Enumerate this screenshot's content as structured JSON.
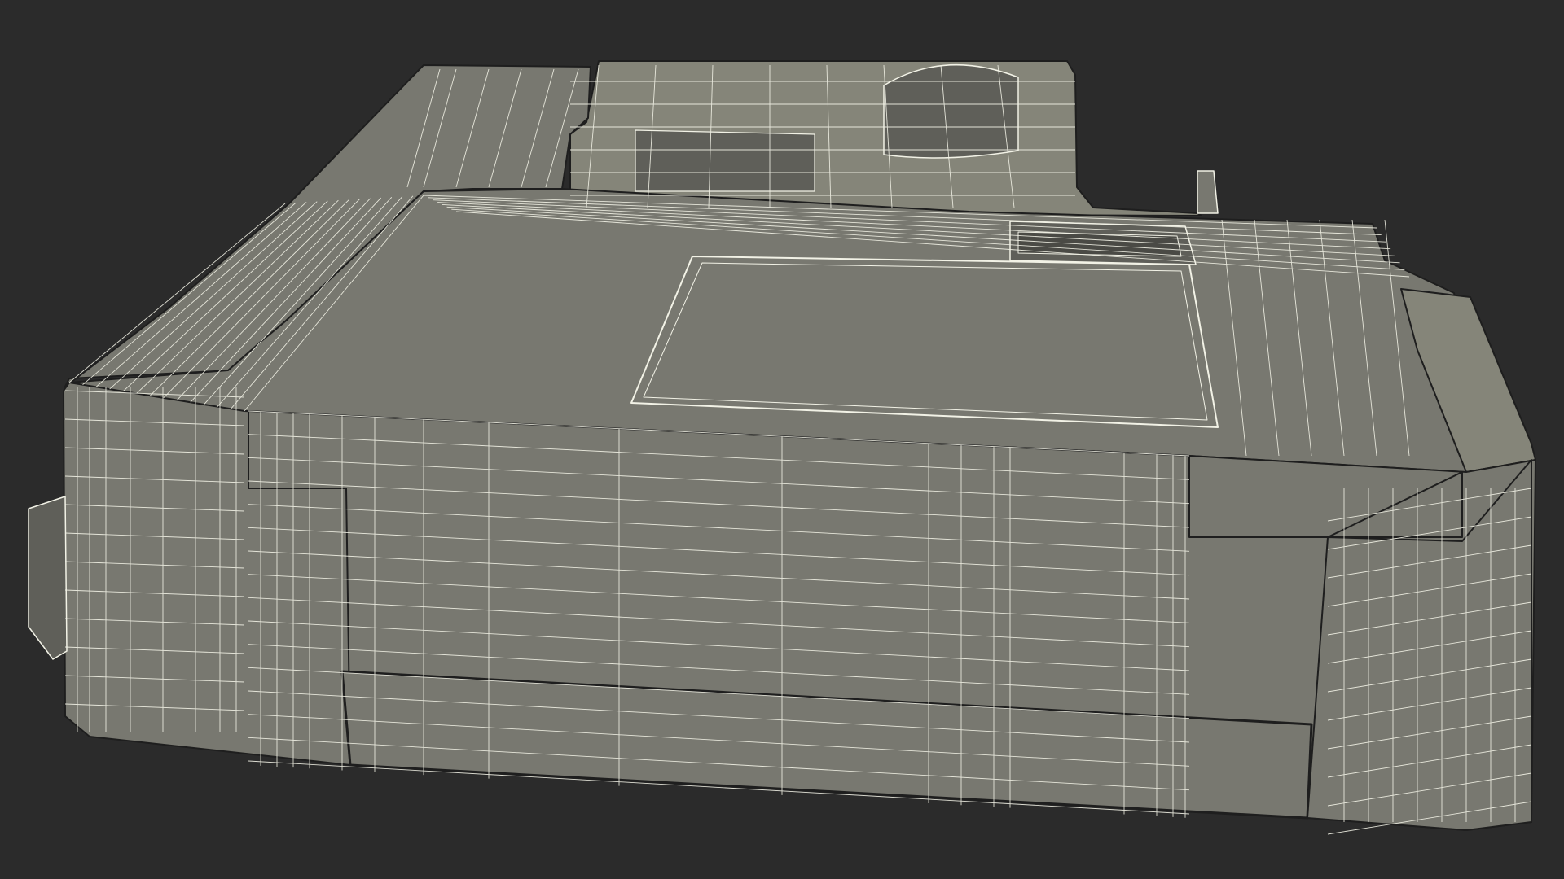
{
  "scene": {
    "subject": "printer-wireframe-render",
    "background_color": "#2b2b2b",
    "surface_color": "#787870",
    "surface_shadow_color": "#5f5f59",
    "surface_light_color": "#858579",
    "wire_color": "#f2f2e6",
    "edge_color": "#1e1e1e"
  }
}
